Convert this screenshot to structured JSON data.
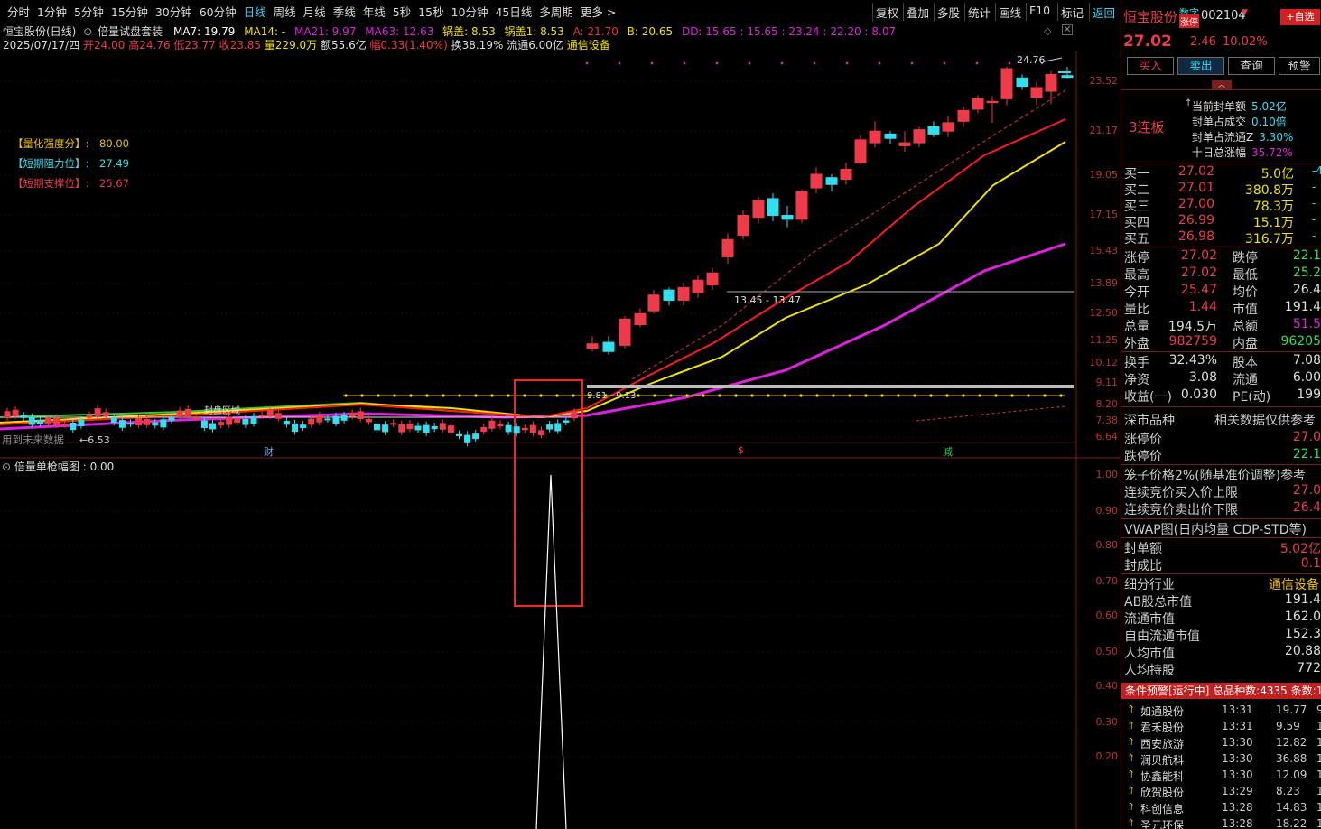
{
  "toolbar": {
    "periods": [
      "分时",
      "1分钟",
      "5分钟",
      "15分钟",
      "30分钟",
      "60分钟",
      "日线",
      "周线",
      "月线",
      "季线",
      "年线",
      "5秒",
      "15秒",
      "10分钟",
      "45日线",
      "多周期",
      "更多 >"
    ],
    "active_period": "日线",
    "right": [
      "复权",
      "叠加",
      "多股",
      "统计",
      "画线",
      "F10",
      "标记",
      "返回"
    ]
  },
  "chart_header": {
    "stock": "恒宝股份(日线)",
    "indicator_set": "倍量试盘套装",
    "ma7": "MA7: 19.79",
    "ma14": "MA14: -",
    "ma21": "MA21: 9.97",
    "ma63": "MA63: 12.63",
    "pot1": "锅盖: 8.53",
    "pot2": "锅盖1: 8.53",
    "a": "A: 21.70",
    "b": "B: 20.65",
    "dd": "DD: 15.65 : 15.65 : 23.24 : 22.20 : 8.07"
  },
  "ohlc_line": {
    "date": "2025/07/17/四",
    "open": "开24.00",
    "high": "高24.76",
    "low": "低23.77",
    "close": "收23.85",
    "volume": "量229.0万",
    "amount": "额55.6亿",
    "change": "幅0.33(1.40%)",
    "turnover": "换38.19%",
    "float": "流通6.00亿",
    "industry": "通信设备"
  },
  "quant_labels": {
    "score_label": "【量化强度分】:",
    "score": "80.00",
    "resist_label": "【短期阻力位】:",
    "resist": "27.49",
    "support_label": "【短期支撑位】:",
    "support": "25.67"
  },
  "annotations": {
    "peak_price": "24.76",
    "line_label": "13.45 - 13.47",
    "low_price": "6.53",
    "future_note": "用到未来数据",
    "band_label": "9.81 - 9.13",
    "old_band": "封盘区域",
    "mark_cai": "财",
    "mark_s": "$",
    "mark_jian": "减"
  },
  "price_axis": [
    "23.52",
    "21.17",
    "19.05",
    "17.15",
    "15.43",
    "13.89",
    "12.50",
    "11.25",
    "10.12",
    "9.11",
    "8.20",
    "7.38",
    "6.64"
  ],
  "sub_chart": {
    "title": "倍量单枪幅图 : 0.00",
    "axis": [
      "1.00",
      "0.90",
      "0.80",
      "0.70",
      "0.60",
      "0.50",
      "0.40",
      "0.30",
      "0.20"
    ]
  },
  "colors": {
    "up": "#f03a4a",
    "down": "#30e0f0",
    "ma7": "#ffffff",
    "ma_red": "#ff1a1a",
    "ma_yellow": "#f0e000",
    "ma_magenta": "#e020e0",
    "accent_red": "#ff3030"
  },
  "quote_panel": {
    "name": "恒宝股份",
    "tag1": "数字",
    "tag2": "涨停",
    "code": "002104",
    "fav": "+自选",
    "price": "27.02",
    "change": "2.46",
    "pct": "10.02%",
    "buttons": [
      "买入",
      "卖出",
      "查询",
      "预警"
    ],
    "board_label": "3连板",
    "seal": [
      {
        "k": "当前封单额",
        "v": "5.02亿"
      },
      {
        "k": "封单占成交",
        "v": "0.10倍"
      },
      {
        "k": "封单占流通Z",
        "v": "3.30%"
      },
      {
        "k": "十日总涨幅",
        "v": "35.72%"
      }
    ],
    "bids": [
      {
        "k": "买一",
        "p": "27.02",
        "v": "5.0亿",
        "x": "-4"
      },
      {
        "k": "买二",
        "p": "27.01",
        "v": "380.8万",
        "x": "-"
      },
      {
        "k": "买三",
        "p": "27.00",
        "v": "78.3万",
        "x": "-"
      },
      {
        "k": "买四",
        "p": "26.99",
        "v": "15.1万",
        "x": "-"
      },
      {
        "k": "买五",
        "p": "26.98",
        "v": "316.7万",
        "x": "-"
      }
    ],
    "stats1": [
      {
        "k": "涨停",
        "v": "27.02",
        "k2": "跌停",
        "v2": "22.1"
      },
      {
        "k": "最高",
        "v": "27.02",
        "k2": "最低",
        "v2": "25.2"
      },
      {
        "k": "今开",
        "v": "25.47",
        "k2": "均价",
        "v2": "26.4"
      },
      {
        "k": "量比",
        "v": "1.44",
        "k2": "市值",
        "v2": "191.4"
      },
      {
        "k": "总量",
        "v": "194.5万",
        "k2": "总额",
        "v2": "51.5"
      },
      {
        "k": "外盘",
        "v": "982759",
        "k2": "内盘",
        "v2": "96205"
      }
    ],
    "stats2": [
      {
        "k": "换手",
        "v": "32.43%",
        "k2": "股本",
        "v2": "7.08"
      },
      {
        "k": "净资",
        "v": "3.08",
        "k2": "流通",
        "v2": "6.00"
      },
      {
        "k": "收益(一)",
        "v": "0.030",
        "k2": "PE(动)",
        "v2": "199"
      }
    ],
    "market": {
      "k": "深市品种",
      "v": "相关数据仅供参考"
    },
    "limits": [
      {
        "k": "涨停价",
        "v": "27.0"
      },
      {
        "k": "跌停价",
        "v": "22.1"
      }
    ],
    "cage": "笼子价格2%(随基准价调整)参考",
    "auction": [
      {
        "k": "连续竞价买入价上限",
        "v": "27.0"
      },
      {
        "k": "连续竞价卖出价下限",
        "v": "26.4"
      }
    ],
    "vwap": "VWAP图(日内均量 CDP-STD等)",
    "seal2": [
      {
        "k": "封单额",
        "v": "5.02亿"
      },
      {
        "k": "封成比",
        "v": "0.1"
      }
    ],
    "industry": {
      "k": "细分行业",
      "v": "通信设备"
    },
    "cap": [
      {
        "k": "AB股总市值",
        "v": "191.4"
      },
      {
        "k": "流通市值",
        "v": "162.0"
      },
      {
        "k": "自由流通市值",
        "v": "152.3"
      },
      {
        "k": "人均市值",
        "v": "20.88"
      },
      {
        "k": "人均持股",
        "v": "772"
      }
    ],
    "alert_header": "条件预警[运行中] 总品种数:4335 条数:1",
    "alerts": [
      {
        "name": "如通股份",
        "time": "13:31",
        "price": "19.77",
        "x": "9"
      },
      {
        "name": "君禾股份",
        "time": "13:31",
        "price": "9.59",
        "x": "1"
      },
      {
        "name": "西安旅游",
        "time": "13:30",
        "price": "12.82",
        "x": "1"
      },
      {
        "name": "润贝航科",
        "time": "13:30",
        "price": "36.88",
        "x": "1"
      },
      {
        "name": "协鑫能科",
        "time": "13:30",
        "price": "12.09",
        "x": "1"
      },
      {
        "name": "欣贺股份",
        "time": "13:29",
        "price": "8.23",
        "x": "1"
      },
      {
        "name": "科创信息",
        "time": "13:28",
        "price": "14.83",
        "x": "1"
      },
      {
        "name": "圣元环保",
        "time": "13:28",
        "price": "18.22",
        "x": "1"
      }
    ]
  }
}
